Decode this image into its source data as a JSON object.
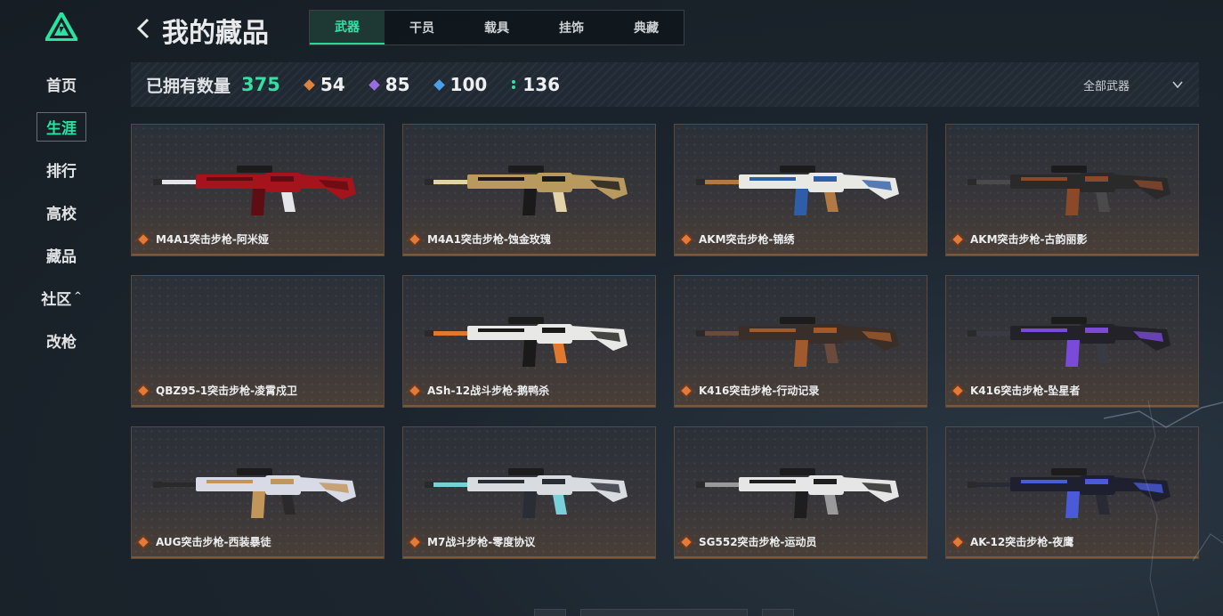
{
  "nav": {
    "items": [
      {
        "label": "首页",
        "active": false
      },
      {
        "label": "生涯",
        "active": true
      },
      {
        "label": "排行",
        "active": false
      },
      {
        "label": "高校",
        "active": false
      },
      {
        "label": "藏品",
        "active": false
      },
      {
        "label": "社区",
        "active": false,
        "caret": "^"
      },
      {
        "label": "改枪",
        "active": false
      }
    ]
  },
  "header": {
    "title": "我的藏品",
    "tabs": [
      {
        "label": "武器",
        "active": true
      },
      {
        "label": "干员",
        "active": false
      },
      {
        "label": "载具",
        "active": false
      },
      {
        "label": "挂饰",
        "active": false
      },
      {
        "label": "典藏",
        "active": false
      }
    ]
  },
  "summary": {
    "own_label": "已拥有数量",
    "own_count": "375",
    "stats": [
      {
        "value": "54",
        "color": "#e0823c",
        "icon": "orange-diamond-icon"
      },
      {
        "value": "85",
        "color": "#9b6be0",
        "icon": "purple-diamond-icon"
      },
      {
        "value": "100",
        "color": "#4aa0e6",
        "icon": "blue-diamond-icon"
      },
      {
        "value": "136",
        "color": "#2fe3a2",
        "icon": "green-dot-icon"
      }
    ],
    "filter_label": "全部武器"
  },
  "colors": {
    "accent": "#2fe3a2",
    "rarity": "#e27a3a",
    "card_border": "#5a4a3d"
  },
  "items": [
    {
      "name": "M4A1突击步枪-阿米娅",
      "skin": "red"
    },
    {
      "name": "M4A1突击步枪-蚀金玫瑰",
      "skin": "gold"
    },
    {
      "name": "AKM突击步枪-锦绣",
      "skin": "blue-white"
    },
    {
      "name": "AKM突击步枪-古韵丽影",
      "skin": "wood"
    },
    {
      "name": "QBZ95-1突击步枪-凌霄戍卫",
      "skin": "none"
    },
    {
      "name": "ASh-12战斗步枪-鹅鸭杀",
      "skin": "white-orange"
    },
    {
      "name": "K416突击步枪-行动记录",
      "skin": "rust"
    },
    {
      "name": "K416突击步枪-坠星者",
      "skin": "purple-dark"
    },
    {
      "name": "AUG突击步枪-西装暴徒",
      "skin": "white-gold"
    },
    {
      "name": "M7战斗步枪-零度协议",
      "skin": "white-ice"
    },
    {
      "name": "SG552突击步枪-运动员",
      "skin": "white-black"
    },
    {
      "name": "AK-12突击步枪-夜鹰",
      "skin": "blue-dark"
    }
  ]
}
